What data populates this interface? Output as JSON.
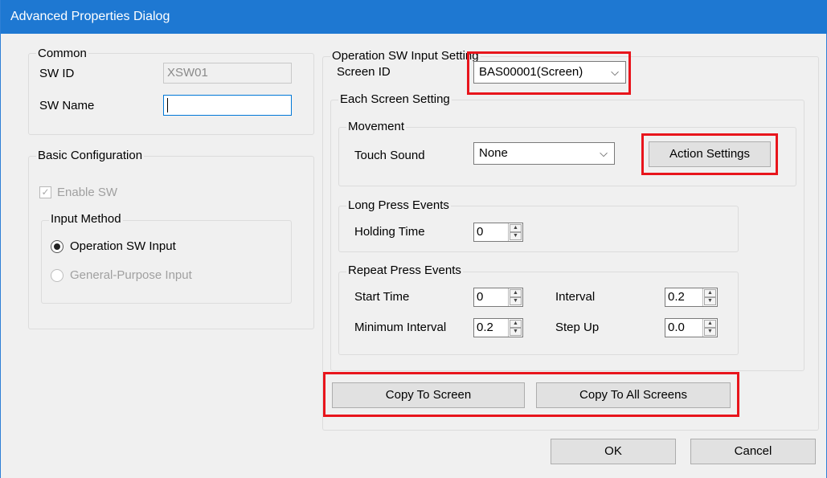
{
  "window": {
    "title": "Advanced Properties Dialog"
  },
  "common": {
    "legend": "Common",
    "sw_id_label": "SW ID",
    "sw_id_value": "XSW01",
    "sw_name_label": "SW Name",
    "sw_name_value": ""
  },
  "basic": {
    "legend": "Basic Configuration",
    "enable_sw_label": "Enable SW",
    "enable_sw_checked": true,
    "input_method_legend": "Input Method",
    "options": [
      {
        "label": "Operation SW Input",
        "selected": true,
        "enabled": true
      },
      {
        "label": "General-Purpose Input",
        "selected": false,
        "enabled": false
      }
    ]
  },
  "operation": {
    "legend": "Operation SW Input Setting",
    "screen_id_label": "Screen ID",
    "screen_id_value": "BAS00001(Screen)",
    "each_screen_legend": "Each Screen Setting",
    "movement_legend": "Movement",
    "touch_sound_label": "Touch Sound",
    "touch_sound_value": "None",
    "action_settings_label": "Action Settings",
    "long_press_legend": "Long Press Events",
    "holding_time_label": "Holding Time",
    "holding_time_value": "0",
    "repeat_legend": "Repeat Press Events",
    "start_time_label": "Start Time",
    "start_time_value": "0",
    "interval_label": "Interval",
    "interval_value": "0.2",
    "min_interval_label": "Minimum Interval",
    "min_interval_value": "0.2",
    "step_up_label": "Step Up",
    "step_up_value": "0.0",
    "copy_to_screen_label": "Copy To Screen",
    "copy_to_all_label": "Copy To All Screens"
  },
  "footer": {
    "ok_label": "OK",
    "cancel_label": "Cancel"
  },
  "colors": {
    "titlebar": "#1e78d2",
    "highlight": "#e8151c"
  },
  "icons": {
    "dropdown": "chevron-down-icon",
    "checkbox": "checkmark-icon"
  }
}
